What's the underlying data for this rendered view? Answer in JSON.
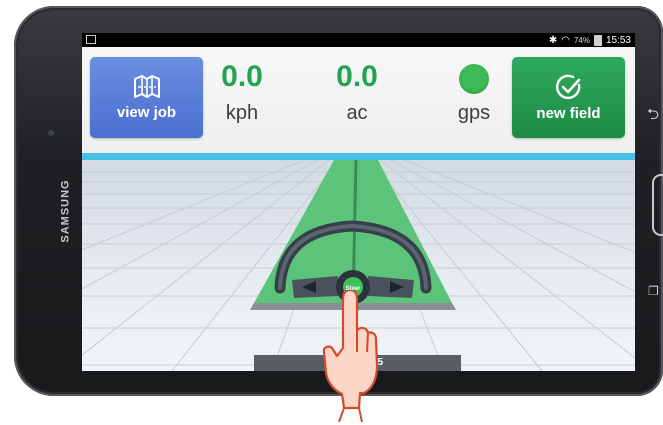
{
  "device": {
    "brand": "SAMSUNG"
  },
  "status_bar": {
    "battery_pct": "74%",
    "time": "15:53"
  },
  "header": {
    "view_job_label": "view job",
    "new_field_label": "new field",
    "speed": {
      "value": "0.0",
      "unit": "kph"
    },
    "area": {
      "value": "0.0",
      "unit": "ac"
    },
    "gps": {
      "unit": "gps",
      "status_color": "#3cbb58"
    }
  },
  "field": {
    "steer_label": "Steer",
    "bottom_tab_text": "W          7.5"
  },
  "colors": {
    "view_job_button": "#5a7ed8",
    "new_field_button": "#27985a",
    "value_green": "#24a353",
    "accent_cyan": "#48bfe6",
    "path_green": "#5cc37a"
  },
  "icons": {
    "view_job": "map-icon",
    "new_field": "check-circle-icon",
    "bluetooth": "bluetooth-icon",
    "wifi": "wifi-icon",
    "battery": "battery-icon"
  }
}
